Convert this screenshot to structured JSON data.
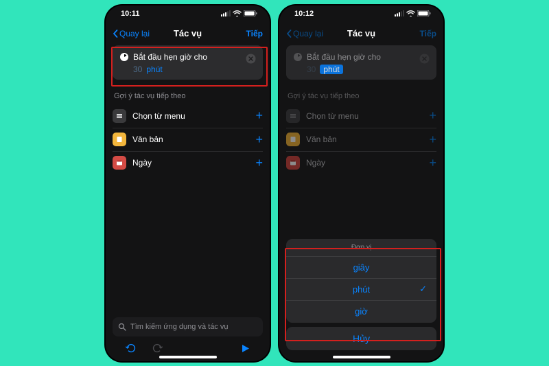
{
  "left": {
    "status": {
      "time": "10:11"
    },
    "nav": {
      "back": "Quay lại",
      "title": "Tác vụ",
      "next": "Tiếp"
    },
    "panel": {
      "title": "Bắt đầu hẹn giờ cho",
      "value": "30",
      "unit": "phút"
    },
    "section_label": "Gợi ý tác vụ tiếp theo",
    "suggestions": [
      {
        "label": "Chọn từ menu"
      },
      {
        "label": "Văn bản"
      },
      {
        "label": "Ngày"
      }
    ],
    "search_placeholder": "Tìm kiếm ứng dụng và tác vụ"
  },
  "right": {
    "status": {
      "time": "10:12"
    },
    "nav": {
      "back": "Quay lại",
      "title": "Tác vụ",
      "next": "Tiếp"
    },
    "panel": {
      "title": "Bắt đầu hẹn giờ cho",
      "value": "30",
      "unit": "phút"
    },
    "section_label": "Gợi ý tác vụ tiếp theo",
    "suggestions": [
      {
        "label": "Chọn từ menu"
      },
      {
        "label": "Văn bản"
      },
      {
        "label": "Ngày"
      }
    ],
    "sheet": {
      "header": "Đơn vị",
      "options": [
        "giây",
        "phút",
        "giờ"
      ],
      "selected": "phút",
      "cancel": "Hủy"
    }
  }
}
